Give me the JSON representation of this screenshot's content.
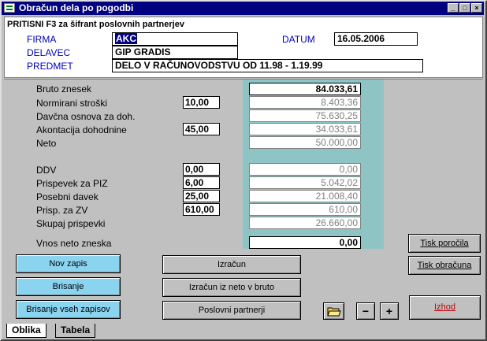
{
  "window": {
    "title": "Obračun dela po pogodbi"
  },
  "titlebar_buttons": {
    "minimize": "_",
    "maximize": "□",
    "close": "×"
  },
  "header": {
    "hint": "PRITISNI F3 za šifrant poslovnih partnerjev",
    "firma_label": "FIRMA",
    "firma_value": "AKC",
    "delavec_label": "DELAVEC",
    "delavec_value": "GIP GRADIS",
    "predmet_label": "PREDMET",
    "predmet_value": "DELO V RAČUNOVODSTVU OD 11.98 - 1.19.99",
    "datum_label": "DATUM",
    "datum_value": "16.05.2006"
  },
  "calc": {
    "bruto_label": "Bruto znesek",
    "bruto_value": "84.033,61",
    "normirani_label": "Normirani stroški",
    "normirani_pct": "10,00",
    "normirani_value": "8.403,36",
    "davcna_label": "Davčna osnova za doh.",
    "davcna_value": "75.630,25",
    "akontacija_label": "Akontacija dohodnine",
    "akontacija_pct": "45,00",
    "akontacija_value": "34.033,61",
    "neto_label": "Neto",
    "neto_value": "50.000,00",
    "ddv_label": "DDV",
    "ddv_pct": "0,00",
    "ddv_value": "0,00",
    "piz_label": "Prispevek za PIZ",
    "piz_pct": "6,00",
    "piz_value": "5.042,02",
    "posebni_label": "Posebni davek",
    "posebni_pct": "25,00",
    "posebni_value": "21.008,40",
    "zv_label": "Prisp. za ZV",
    "zv_pct": "610,00",
    "zv_value": "610,00",
    "skupaj_label": "Skupaj prispevki",
    "skupaj_value": "26.660,00",
    "vnos_label": "Vnos neto zneska",
    "vnos_value": "0,00"
  },
  "buttons": {
    "nov_zapis": "Nov zapis",
    "brisanje": "Brisanje",
    "brisanje_vseh": "Brisanje vseh zapisov",
    "izracun": "Izračun",
    "izracun_iz_neto": "Izračun iz neto v bruto",
    "poslovni_partnerji": "Poslovni partnerji",
    "tisk_porocila": "Tisk poročila",
    "tisk_obracuna": "Tisk obračuna",
    "izhod": "Izhod",
    "minus": "−",
    "plus": "+"
  },
  "tabs": {
    "oblika": "Oblika",
    "tabela": "Tabela"
  },
  "colors": {
    "titlebar": "#000080",
    "teal_panel": "#8fc4c4",
    "cyan_button": "#8ad4f0",
    "label_blue": "#0000c0",
    "exit_red": "#c00000"
  }
}
